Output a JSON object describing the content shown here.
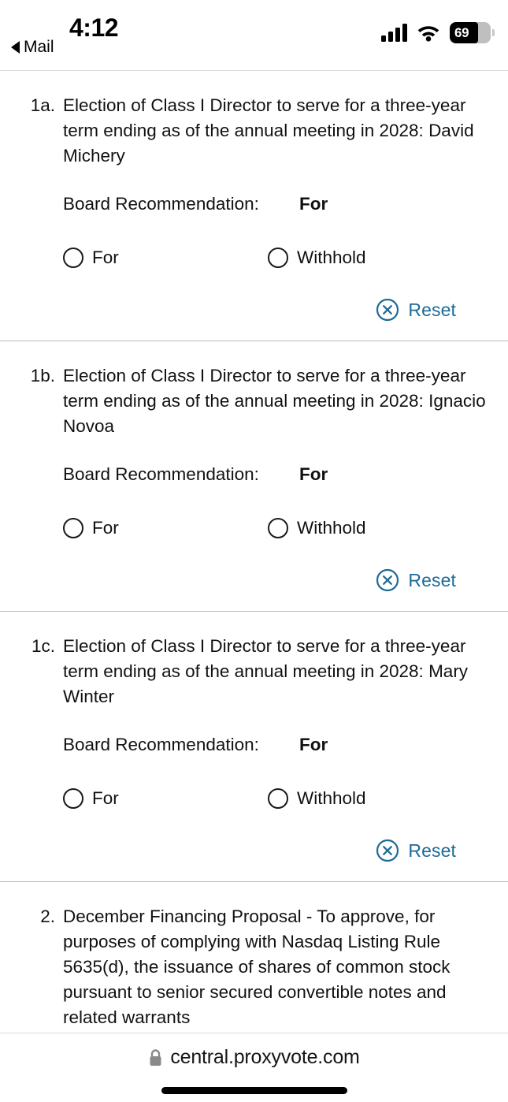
{
  "status_bar": {
    "time": "4:12",
    "back_app_label": "Mail",
    "back_caret_icon": "back-triangle-icon",
    "signal_icon": "cellular-signal-icon",
    "wifi_icon": "wifi-icon",
    "battery_icon": "battery-icon",
    "battery_percent": "69",
    "battery_level": 69
  },
  "colors": {
    "accent_link": "#1d6b97",
    "text": "#111111",
    "divider": "#b9b9b9",
    "radio_border": "#1a1a1a",
    "battery_fill": "#000000",
    "battery_track": "#bfbfbf"
  },
  "proposals": [
    {
      "number": "1a.",
      "text": "Election of Class I Director to serve for a three-year term ending as of the annual meeting in 2028: David Michery",
      "recommendation_label": "Board Recommendation:",
      "recommendation_value": "For",
      "options": [
        "For",
        "Withhold"
      ],
      "selected": null,
      "reset_label": "Reset",
      "reset_icon": "x-circle-icon"
    },
    {
      "number": "1b.",
      "text": "Election of Class I Director to serve for a three-year term ending as of the annual meeting in 2028: Ignacio Novoa",
      "recommendation_label": "Board Recommendation:",
      "recommendation_value": "For",
      "options": [
        "For",
        "Withhold"
      ],
      "selected": null,
      "reset_label": "Reset",
      "reset_icon": "x-circle-icon"
    },
    {
      "number": "1c.",
      "text": "Election of Class I Director to serve for a three-year term ending as of the annual meeting in 2028: Mary Winter",
      "recommendation_label": "Board Recommendation:",
      "recommendation_value": "For",
      "options": [
        "For",
        "Withhold"
      ],
      "selected": null,
      "reset_label": "Reset",
      "reset_icon": "x-circle-icon"
    },
    {
      "number": "2.",
      "text": "December Financing Proposal - To approve, for purposes of complying with Nasdaq Listing Rule 5635(d), the issuance of shares of common stock pursuant to senior secured convertible notes and related warrants",
      "partially_visible": true
    }
  ],
  "browser_bar": {
    "lock_icon": "lock-icon",
    "url": "central.proxyvote.com",
    "home_indicator": "home-indicator"
  }
}
